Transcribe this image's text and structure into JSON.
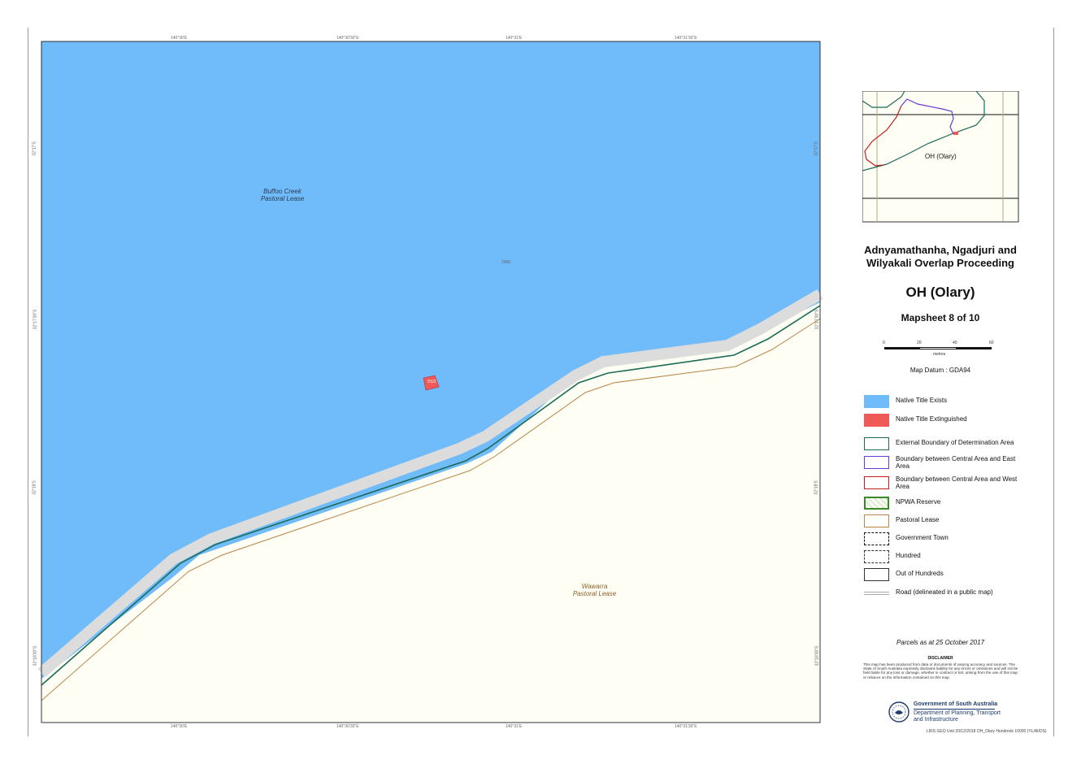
{
  "map": {
    "labels": {
      "buffoo_creek": "Buffoo Creek\nPastoral Lease",
      "wawarra": "Wawarra\nPastoral Lease",
      "small_marker": "2990",
      "parcel": "D1/2"
    },
    "ticks": {
      "top": [
        "140°30'E",
        "140°30'30\"E",
        "140°31'E",
        "140°31'30\"E"
      ],
      "bottom": [
        "140°30'E",
        "140°30'30\"E",
        "140°31'E",
        "140°31'30\"E"
      ],
      "left": [
        "32°17'S",
        "32°17'30\"S",
        "32°18'S",
        "32°18'30\"S"
      ],
      "right": [
        "32°17'S",
        "32°17'30\"S",
        "32°18'S",
        "32°18'30\"S"
      ]
    },
    "colors": {
      "native_title_exists": "#70bbf9",
      "native_title_extinguished": "#ef5a56",
      "land": "#fefef4",
      "road": "#dcdcdc",
      "external_boundary": "#1b6b56",
      "pastoral_lease": "#b9854a"
    }
  },
  "inset": {
    "label": "OH (Olary)"
  },
  "title": {
    "line1": "Adnyamathanha, Ngadjuri and",
    "line2": "Wilyakali Overlap Proceeding",
    "subtitle": "OH (Olary)",
    "mapsheet": "Mapsheet 8 of 10"
  },
  "scale": {
    "ticks": [
      "0",
      "20",
      "40",
      "60"
    ],
    "unit": "metres",
    "datum": "Map Datum : GDA94"
  },
  "legend": [
    {
      "label": "Native Title Exists",
      "icon": "fill-blue"
    },
    {
      "label": "Native Title Extinguished",
      "icon": "fill-red"
    },
    {
      "label": "External Boundary of Determination Area",
      "icon": "outline-green"
    },
    {
      "label": "Boundary between Central Area and East Area",
      "icon": "outline-purple"
    },
    {
      "label": "Boundary between Central Area and West Area",
      "icon": "outline-red"
    },
    {
      "label": "NPWA Reserve",
      "icon": "hatched-green"
    },
    {
      "label": "Pastoral Lease",
      "icon": "outline-brown"
    },
    {
      "label": "Government Town",
      "icon": "dashdot-black"
    },
    {
      "label": "Hundred",
      "icon": "dashed-black"
    },
    {
      "label": "Out of Hundreds",
      "icon": "outline-black"
    },
    {
      "label": "Road (delineated in a public map)",
      "icon": "double-grey-line"
    }
  ],
  "parcels_date": "Parcels as at 25 October 2017",
  "disclaimer": {
    "title": "DISCLAIMER",
    "text": "This map has been produced from data or documents of varying accuracy and sources. The State of South Australia expressly disclaims liability for any errors or omissions and will not be held liable for any loss or damage, whether in contract or tort, arising from the use of this map or reliance on the information contained on this map."
  },
  "agency": {
    "line1": "Government of South Australia",
    "line2": "Department of Planning, Transport and Infrastructure"
  },
  "footer_ref": "LRIS GEO Unit 20/12/2018 OH_Olary Hundreds 10000 (YL/AI/DS)"
}
